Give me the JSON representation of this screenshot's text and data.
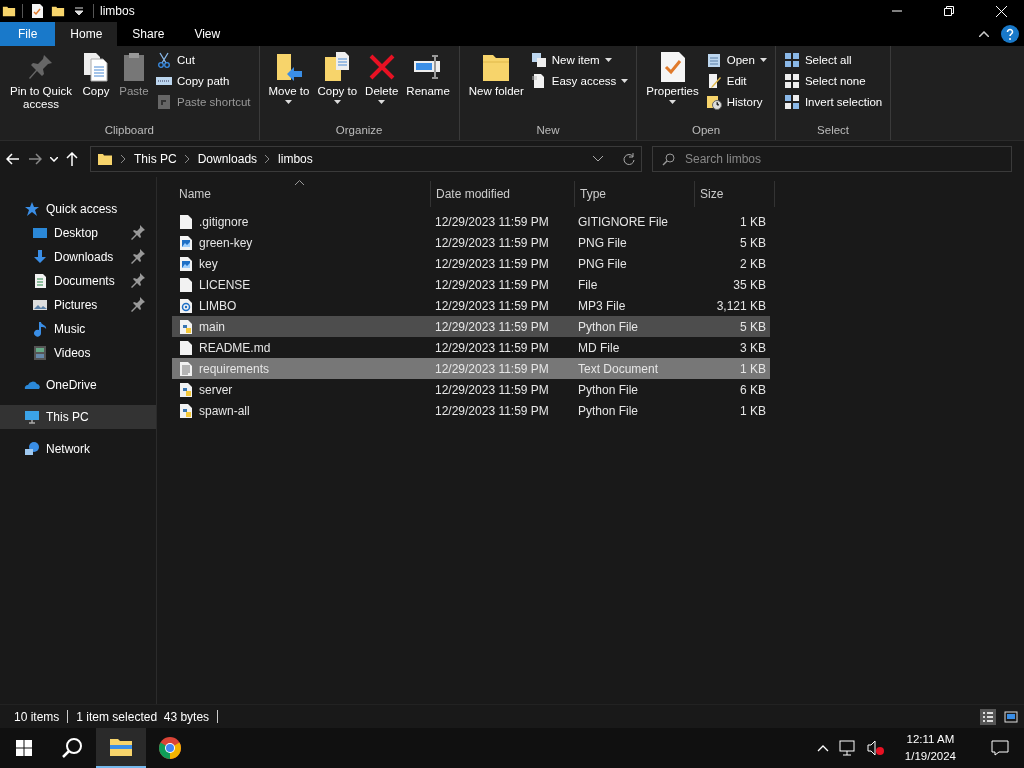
{
  "window": {
    "title": "limbos"
  },
  "tabs": [
    {
      "label": "File",
      "kind": "file",
      "selected": false
    },
    {
      "label": "Home",
      "kind": "tab",
      "selected": true
    },
    {
      "label": "Share",
      "kind": "tab",
      "selected": false
    },
    {
      "label": "View",
      "kind": "tab",
      "selected": false
    }
  ],
  "ribbon": [
    {
      "label": "Clipboard",
      "items": [
        {
          "kind": "large",
          "label": "Pin to Quick access",
          "dropdown": false,
          "disabled": false
        },
        {
          "kind": "large",
          "label": "Copy",
          "dropdown": false,
          "disabled": false
        },
        {
          "kind": "large",
          "label": "Paste",
          "dropdown": false,
          "disabled": true
        },
        {
          "kind": "small",
          "label": "Cut",
          "dropdown": false,
          "disabled": false
        },
        {
          "kind": "small",
          "label": "Copy path",
          "dropdown": false,
          "disabled": false
        },
        {
          "kind": "small",
          "label": "Paste shortcut",
          "dropdown": false,
          "disabled": true
        }
      ]
    },
    {
      "label": "Organize",
      "items": [
        {
          "kind": "large",
          "label": "Move to",
          "dropdown": true,
          "disabled": false
        },
        {
          "kind": "large",
          "label": "Copy to",
          "dropdown": true,
          "disabled": false
        },
        {
          "kind": "large",
          "label": "Delete",
          "dropdown": true,
          "disabled": false
        },
        {
          "kind": "large",
          "label": "Rename",
          "dropdown": false,
          "disabled": false
        }
      ]
    },
    {
      "label": "New",
      "items": [
        {
          "kind": "large",
          "label": "New folder",
          "dropdown": false,
          "disabled": false
        },
        {
          "kind": "small",
          "label": "New item",
          "dropdown": true,
          "disabled": false
        },
        {
          "kind": "small",
          "label": "Easy access",
          "dropdown": true,
          "disabled": false
        }
      ]
    },
    {
      "label": "Open",
      "items": [
        {
          "kind": "large",
          "label": "Properties",
          "dropdown": true,
          "disabled": false
        },
        {
          "kind": "small",
          "label": "Open",
          "dropdown": true,
          "disabled": false
        },
        {
          "kind": "small",
          "label": "Edit",
          "dropdown": false,
          "disabled": false
        },
        {
          "kind": "small",
          "label": "History",
          "dropdown": false,
          "disabled": false
        }
      ]
    },
    {
      "label": "Select",
      "items": [
        {
          "kind": "small",
          "label": "Select all",
          "dropdown": false,
          "disabled": false
        },
        {
          "kind": "small",
          "label": "Select none",
          "dropdown": false,
          "disabled": false
        },
        {
          "kind": "small",
          "label": "Invert selection",
          "dropdown": false,
          "disabled": false
        }
      ]
    }
  ],
  "address": {
    "crumbs": [
      "This PC",
      "Downloads",
      "limbos"
    ]
  },
  "search": {
    "placeholder": "Search limbos"
  },
  "sidebar": {
    "items": [
      {
        "label": "Quick access",
        "selected": false,
        "children": [
          {
            "label": "Desktop",
            "pinned": true,
            "selected": false
          },
          {
            "label": "Downloads",
            "pinned": true,
            "selected": false
          },
          {
            "label": "Documents",
            "pinned": true,
            "selected": false
          },
          {
            "label": "Pictures",
            "pinned": true,
            "selected": false
          },
          {
            "label": "Music",
            "pinned": false,
            "selected": false
          },
          {
            "label": "Videos",
            "pinned": false,
            "selected": false
          }
        ]
      },
      {
        "label": "OneDrive",
        "selected": false
      },
      {
        "label": "This PC",
        "selected": true
      },
      {
        "label": "Network",
        "selected": false
      }
    ]
  },
  "table": {
    "columns": [
      "Name",
      "Date modified",
      "Type",
      "Size"
    ],
    "rows": [
      {
        "kind": "blank",
        "name": ".gitignore",
        "date": "12/29/2023 11:59 PM",
        "type": "GITIGNORE File",
        "size": "1 KB",
        "selected": false,
        "hovered": false
      },
      {
        "kind": "image",
        "name": "green-key",
        "date": "12/29/2023 11:59 PM",
        "type": "PNG File",
        "size": "5 KB",
        "selected": false,
        "hovered": false
      },
      {
        "kind": "image",
        "name": "key",
        "date": "12/29/2023 11:59 PM",
        "type": "PNG File",
        "size": "2 KB",
        "selected": false,
        "hovered": false
      },
      {
        "kind": "blank",
        "name": "LICENSE",
        "date": "12/29/2023 11:59 PM",
        "type": "File",
        "size": "35 KB",
        "selected": false,
        "hovered": false
      },
      {
        "kind": "audio",
        "name": "LIMBO",
        "date": "12/29/2023 11:59 PM",
        "type": "MP3 File",
        "size": "3,121 KB",
        "selected": false,
        "hovered": false
      },
      {
        "kind": "python",
        "name": "main",
        "date": "12/29/2023 11:59 PM",
        "type": "Python File",
        "size": "5 KB",
        "selected": false,
        "hovered": true
      },
      {
        "kind": "blank",
        "name": "README.md",
        "date": "12/29/2023 11:59 PM",
        "type": "MD File",
        "size": "3 KB",
        "selected": false,
        "hovered": false
      },
      {
        "kind": "text",
        "name": "requirements",
        "date": "12/29/2023 11:59 PM",
        "type": "Text Document",
        "size": "1 KB",
        "selected": true,
        "hovered": false
      },
      {
        "kind": "python",
        "name": "server",
        "date": "12/29/2023 11:59 PM",
        "type": "Python File",
        "size": "6 KB",
        "selected": false,
        "hovered": false
      },
      {
        "kind": "python",
        "name": "spawn-all",
        "date": "12/29/2023 11:59 PM",
        "type": "Python File",
        "size": "1 KB",
        "selected": false,
        "hovered": false
      }
    ]
  },
  "status_bar": {
    "count": "10 items",
    "selection": "1 item selected  43 bytes"
  },
  "taskbar": {
    "time": "12:11 AM",
    "date": "1/19/2024"
  }
}
